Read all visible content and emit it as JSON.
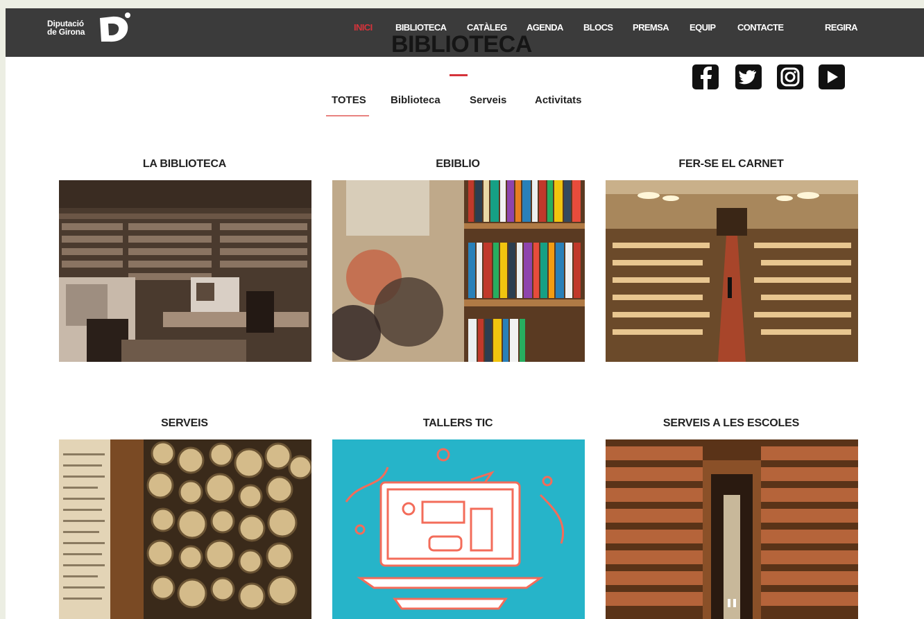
{
  "brand": {
    "line1": "Diputació",
    "line2": "de Girona",
    "logo_letter": "D"
  },
  "nav": {
    "items": [
      {
        "label": "INICI",
        "active": true
      },
      {
        "label": "BIBLIOTECA"
      },
      {
        "label": "CATÀLEG"
      },
      {
        "label": "AGENDA"
      },
      {
        "label": "BLOCS"
      },
      {
        "label": "PREMSA"
      },
      {
        "label": "EQUIP"
      },
      {
        "label": "CONTACTE"
      },
      {
        "label": "REGIRA"
      }
    ]
  },
  "page_title": "BIBLIOTECA",
  "social": [
    "facebook-icon",
    "twitter-icon",
    "instagram-icon",
    "youtube-icon"
  ],
  "filters": [
    {
      "label": "TOTES",
      "active": true
    },
    {
      "label": "Biblioteca"
    },
    {
      "label": "Serveis"
    },
    {
      "label": "Activitats"
    }
  ],
  "cards": [
    {
      "title": "LA BIBLIOTECA"
    },
    {
      "title": "EBIBLIO"
    },
    {
      "title": "FER-SE EL CARNET"
    },
    {
      "title": "SERVEIS"
    },
    {
      "title": "TALLERS TIC"
    },
    {
      "title": "SERVEIS A LES ESCOLES"
    }
  ],
  "colors": {
    "accent": "#d5333b",
    "topbar": "#3b3b3b",
    "tic_bg": "#26b4c9"
  }
}
